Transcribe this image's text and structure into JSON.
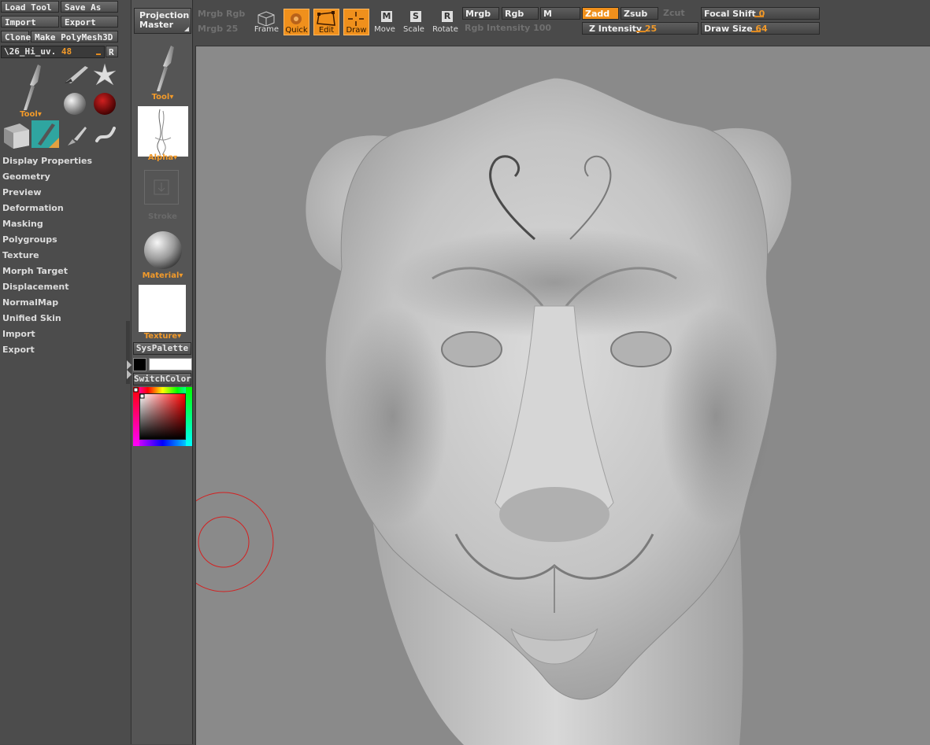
{
  "left_panel": {
    "buttons": {
      "load_tool": "Load Tool",
      "save_as": "Save As",
      "import": "Import",
      "export": "Export",
      "clone": "Clone",
      "make_polymesh": "Make PolyMesh3D"
    },
    "current_tool": {
      "name": "\\26_Hi_uv.",
      "value": "48",
      "reset_label": "R"
    },
    "tool_label": "Tool",
    "menu_items": [
      "Display Properties",
      "Geometry",
      "Preview",
      "Deformation",
      "Masking",
      "Polygroups",
      "Texture",
      "Morph Target",
      "Displacement",
      "NormalMap",
      "Unified Skin",
      "Import",
      "Export"
    ]
  },
  "shelf": {
    "projection_master": "Projection Master",
    "tool_label": "Tool",
    "alpha_label": "Alpha",
    "stroke_label": "Stroke",
    "material_label": "Material",
    "texture_label": "Texture",
    "syspalette_label": "SysPalette",
    "switchcolor_label": "SwitchColor"
  },
  "toolbar": {
    "dim_top": [
      "Mrgb",
      "Rgb"
    ],
    "dim_bottom": "Mrgb",
    "dim_bottom_val": "25",
    "tools": [
      {
        "label": "Frame",
        "icon": "frame-icon",
        "active": false
      },
      {
        "label": "Quick",
        "icon": "quick-icon",
        "active": true
      },
      {
        "label": "Edit",
        "icon": "edit-icon",
        "active": true
      },
      {
        "label": "Draw",
        "icon": "draw-icon",
        "active": true
      },
      {
        "label": "Move",
        "icon": "move-icon",
        "active": false
      },
      {
        "label": "Scale",
        "icon": "scale-icon",
        "active": false
      },
      {
        "label": "Rotate",
        "icon": "rotate-icon",
        "active": false
      }
    ],
    "move_letter": "M",
    "scale_letter": "S",
    "rotate_letter": "R",
    "mrgb": "Mrgb",
    "rgb": "Rgb",
    "m": "M",
    "zadd": "Zadd",
    "zsub": "Zsub",
    "zcut": "Zcut",
    "rgb_intensity_label": "Rgb Intensity",
    "rgb_intensity_value": "100",
    "z_intensity_label": "Z Intensity",
    "z_intensity_value": "25",
    "focal_shift_label": "Focal Shift",
    "focal_shift_value": "0",
    "draw_size_label": "Draw Size",
    "draw_size_value": "64"
  },
  "colors": {
    "accent": "#f0901c",
    "canvas_bg": "#8a8a8a",
    "brush_cursor": "#d42020"
  }
}
